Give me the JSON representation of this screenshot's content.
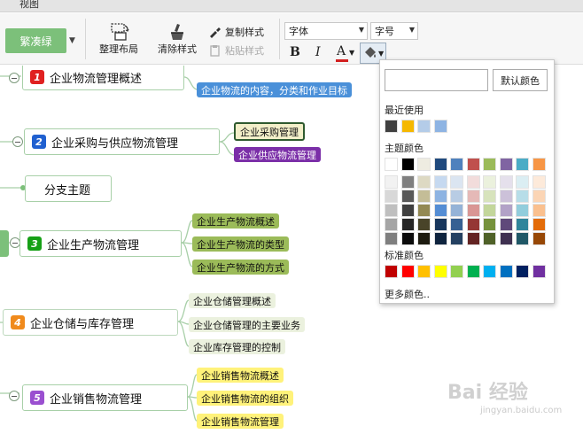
{
  "menubar": {
    "view_label": "视图"
  },
  "toolbar": {
    "style_button": "繁凑绿",
    "arrange_layout": "整理布局",
    "clear_style": "清除样式",
    "copy_style": "复制样式",
    "paste_style": "粘贴样式",
    "font_placeholder": "字体",
    "size_placeholder": "字号",
    "bold": "B",
    "italic": "I",
    "font_color": "A"
  },
  "mindmap": {
    "branches": [
      {
        "index": "1",
        "title": "企业物流管理概述",
        "badge_color": "#e02020",
        "children": [
          "企业物流的内容，分类和作业目标"
        ]
      },
      {
        "index": "2",
        "title": "企业采购与供应物流管理",
        "badge_color": "#2060d0",
        "children": [
          "企业采购管理",
          "企业供应物流管理"
        ]
      },
      {
        "index": "",
        "title": "分支主题",
        "badge_color": "",
        "children": []
      },
      {
        "index": "3",
        "title": "企业生产物流管理",
        "badge_color": "#16a016",
        "children": [
          "企业生产物流概述",
          "企业生产物流的类型",
          "企业生产物流的方式"
        ]
      },
      {
        "index": "4",
        "title": "企业仓储与库存管理",
        "badge_color": "#f08a1c",
        "children": [
          "企业仓储管理概述",
          "企业仓储管理的主要业务",
          "企业库存管理的控制"
        ]
      },
      {
        "index": "5",
        "title": "企业销售物流管理",
        "badge_color": "#9a4fd0",
        "children": [
          "企业销售物流概述",
          "企业销售物流的组织",
          "企业销售物流管理"
        ]
      }
    ]
  },
  "color_picker": {
    "default_color_button": "默认颜色",
    "recent_label": "最近使用",
    "theme_label": "主题颜色",
    "standard_label": "标准颜色",
    "more_colors": "更多颜色..",
    "recent": [
      "#404040",
      "#f5b800",
      "#b4cce8",
      "#8eb4e3"
    ],
    "theme_top": [
      "#ffffff",
      "#000000",
      "#eeece1",
      "#1f497d",
      "#4f81bd",
      "#c0504d",
      "#9bbb59",
      "#8064a2",
      "#4bacc6",
      "#f79646"
    ],
    "theme_shades": [
      [
        "#f2f2f2",
        "#7f7f7f",
        "#ddd9c3",
        "#c6d9f0",
        "#dbe5f1",
        "#f2dcdb",
        "#ebf1dd",
        "#e5e0ec",
        "#dbeef3",
        "#fdeada"
      ],
      [
        "#d8d8d8",
        "#595959",
        "#c4bd97",
        "#8db3e2",
        "#b8cce4",
        "#e5b9b7",
        "#d7e3bc",
        "#ccc1d9",
        "#b7dde8",
        "#fbd5b5"
      ],
      [
        "#bfbfbf",
        "#3f3f3f",
        "#938953",
        "#548dd4",
        "#95b3d7",
        "#d99694",
        "#c3d69b",
        "#b2a2c7",
        "#92cddc",
        "#fac08f"
      ],
      [
        "#a5a5a5",
        "#262626",
        "#494429",
        "#17365d",
        "#366092",
        "#953734",
        "#76923c",
        "#5f497a",
        "#31859b",
        "#e36c09"
      ],
      [
        "#7f7f7f",
        "#0c0c0c",
        "#1d1b10",
        "#0f243e",
        "#244061",
        "#632423",
        "#4f6128",
        "#3f3151",
        "#205867",
        "#974806"
      ]
    ],
    "standard": [
      "#c00000",
      "#ff0000",
      "#ffc000",
      "#ffff00",
      "#92d050",
      "#00b050",
      "#00b0f0",
      "#0070c0",
      "#002060",
      "#7030a0"
    ]
  },
  "watermark": {
    "text": "Bai 经验",
    "sub": "jingyan.baidu.com"
  }
}
